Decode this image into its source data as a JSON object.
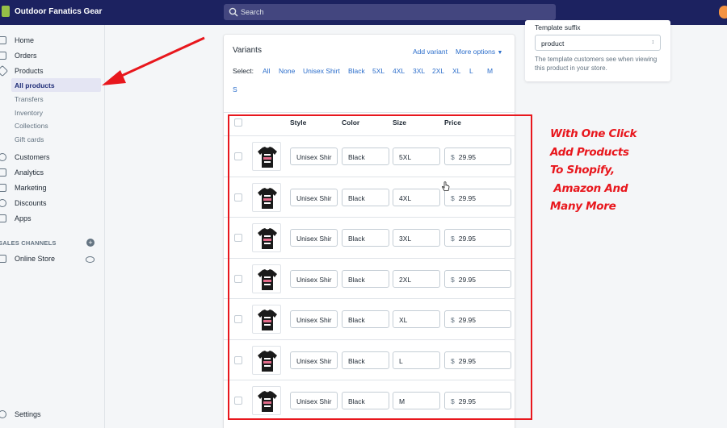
{
  "topbar": {
    "store_name": "Outdoor Fanatics Gear",
    "search_placeholder": "Search"
  },
  "sidebar": {
    "items": [
      {
        "label": "Home",
        "icon": "home-icon"
      },
      {
        "label": "Orders",
        "icon": "orders-icon"
      },
      {
        "label": "Products",
        "icon": "tag-icon"
      }
    ],
    "product_subitems": [
      "All products",
      "Transfers",
      "Inventory",
      "Collections",
      "Gift cards"
    ],
    "items2": [
      {
        "label": "Customers",
        "icon": "person-icon"
      },
      {
        "label": "Analytics",
        "icon": "analytics-icon"
      },
      {
        "label": "Marketing",
        "icon": "megaphone-icon"
      },
      {
        "label": "Discounts",
        "icon": "discount-icon"
      },
      {
        "label": "Apps",
        "icon": "apps-icon"
      }
    ],
    "sales_channels_label": "SALES CHANNELS",
    "online_store_label": "Online Store",
    "settings_label": "Settings"
  },
  "variants_card": {
    "title": "Variants",
    "add_variant": "Add variant",
    "more_options": "More options",
    "select_label": "Select:",
    "select_options": [
      "All",
      "None",
      "Unisex Shirt",
      "Black",
      "5XL",
      "4XL",
      "3XL",
      "2XL",
      "XL",
      "L",
      "M",
      "S"
    ],
    "columns": [
      "Style",
      "Color",
      "Size",
      "Price"
    ],
    "currency": "$",
    "rows": [
      {
        "style": "Unisex Shir",
        "color": "Black",
        "size": "5XL",
        "price": "29.95"
      },
      {
        "style": "Unisex Shir",
        "color": "Black",
        "size": "4XL",
        "price": "29.95"
      },
      {
        "style": "Unisex Shir",
        "color": "Black",
        "size": "3XL",
        "price": "29.95"
      },
      {
        "style": "Unisex Shir",
        "color": "Black",
        "size": "2XL",
        "price": "29.95"
      },
      {
        "style": "Unisex Shir",
        "color": "Black",
        "size": "XL",
        "price": "29.95"
      },
      {
        "style": "Unisex Shir",
        "color": "Black",
        "size": "L",
        "price": "29.95"
      },
      {
        "style": "Unisex Shir",
        "color": "Black",
        "size": "M",
        "price": "29.95"
      }
    ]
  },
  "template_card": {
    "label": "Template suffix",
    "value": "product",
    "help": "The template customers see when viewing this product in your store."
  },
  "promo": {
    "text": "With One Click\nAdd Products\nTo Shopify,\n Amazon And\nMany More",
    "color": "#e8171d"
  },
  "colors": {
    "topbar": "#1c2260",
    "accent_link": "#2c6ecb",
    "annotation_red": "#e8171d"
  }
}
